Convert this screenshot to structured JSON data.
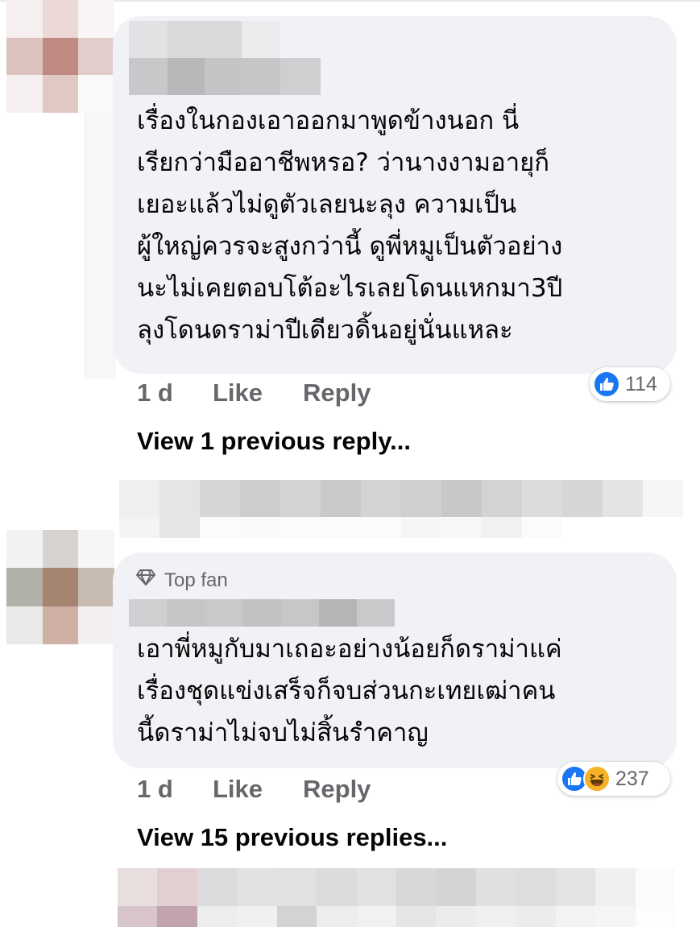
{
  "comments": [
    {
      "lines": [
        "เรื่องในกองเอาออกมาพูดข้างนอก นี่",
        "เรียกว่ามืออาชีพหรอ? ว่านางงามอายุก็",
        "เยอะแล้วไม่ดูตัวเลยนะลุง ความเป็น",
        "ผู้ใหญ่ควรจะสูงกว่านี้ ดูพี่หมูเป็นตัวอย่าง",
        "นะไม่เคยตอบโต้อะไรเลยโดนแหกมา3ปี",
        "ลุงโดนดราม่าปีเดียวดิ้นอยู่นั่นแหละ"
      ],
      "time": "1 d",
      "like_label": "Like",
      "reply_label": "Reply",
      "reaction_count": "114",
      "reactions": [
        "like-icon"
      ],
      "view_replies": "View 1 previous reply..."
    },
    {
      "badge": "Top fan",
      "badge_icon": "diamond-icon",
      "lines": [
        "เอาพี่หมูกับมาเถอะอย่างน้อยก็ดราม่าแค่",
        "เรื่องชุดแข่งเสร็จก็จบส่วนกะเทยเฒ่าคน",
        "นี้ดราม่าไม่จบไม่สิ้นรำคาญ"
      ],
      "time": "1 d",
      "like_label": "Like",
      "reply_label": "Reply",
      "reaction_count": "237",
      "reactions": [
        "like-icon",
        "haha-icon"
      ],
      "view_replies": "View 15 previous replies..."
    }
  ],
  "colors": {
    "bubble": "#f0f2f5",
    "meta_text": "#65676b",
    "like_blue": "#1877f2",
    "haha_yellow": "#f7b125"
  }
}
